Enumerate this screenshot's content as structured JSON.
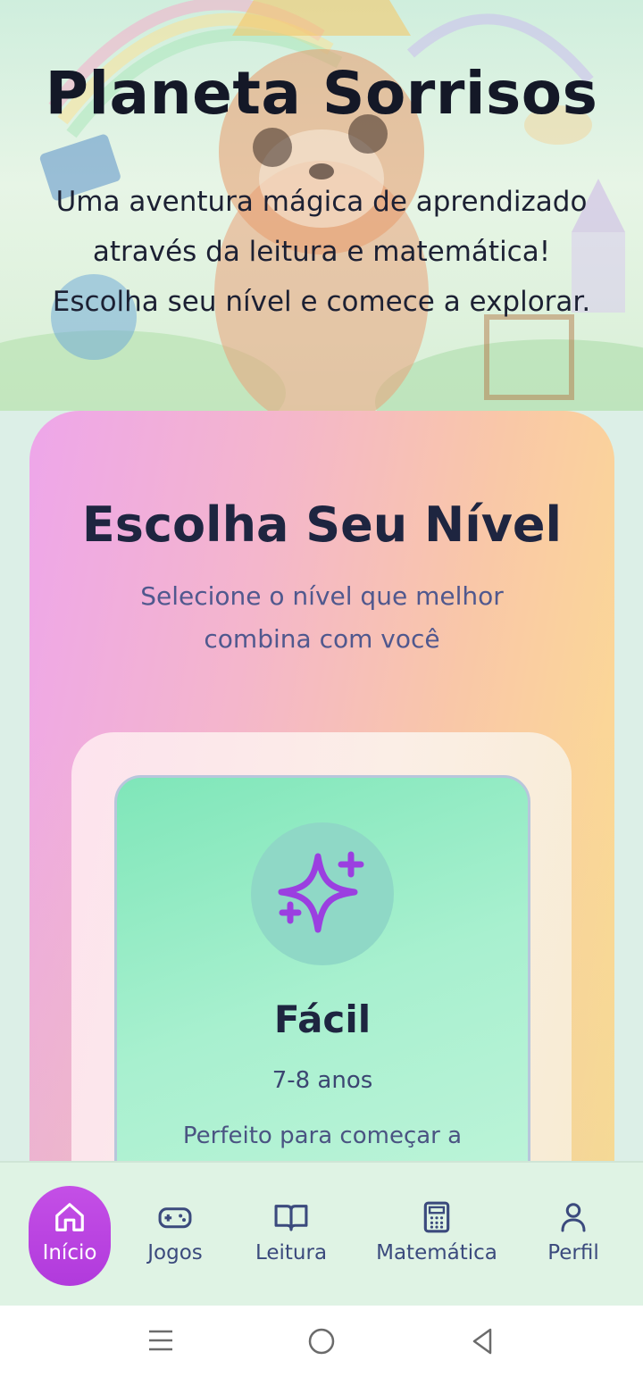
{
  "hero": {
    "title": "Planeta Sorrisos",
    "subtitle_lines": [
      "Uma aventura mágica de aprendizado",
      "através da leitura e matemática!",
      "Escolha seu nível e comece a explorar."
    ]
  },
  "level_section": {
    "title": "Escolha Seu Nível",
    "subtitle_lines": [
      "Selecione o nível que melhor",
      "combina com você"
    ]
  },
  "level_option": {
    "icon": "sparkles-icon",
    "title": "Fácil",
    "age": "7-8 anos",
    "description": "Perfeito para começar a"
  },
  "bottom_nav": {
    "items": [
      {
        "label": "Início",
        "icon": "home-icon",
        "active": true
      },
      {
        "label": "Jogos",
        "icon": "gamepad-icon"
      },
      {
        "label": "Leitura",
        "icon": "book-icon"
      },
      {
        "label": "Matemática",
        "icon": "calculator-icon"
      },
      {
        "label": "Perfil",
        "icon": "user-icon"
      }
    ]
  },
  "colors": {
    "accent": "#b13adc",
    "text_dark": "#1e2540",
    "nav_text": "#3b4a7d"
  }
}
